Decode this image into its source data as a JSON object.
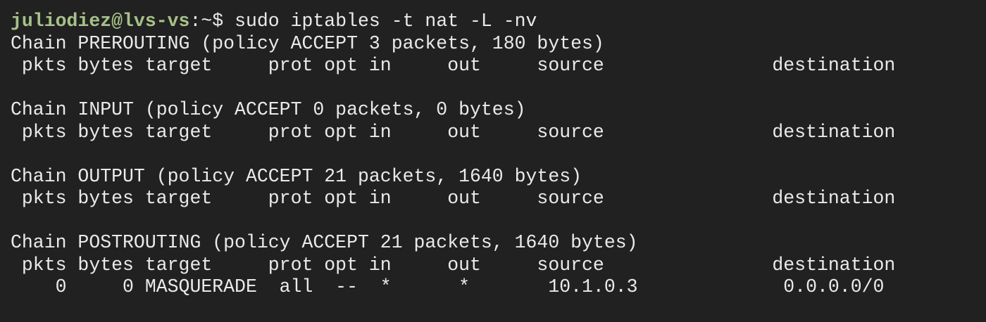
{
  "terminal": {
    "prompt": {
      "user_host": "juliodiez@lvs-vs",
      "path_symbol": ":~$",
      "command": " sudo iptables -t nat -L -nv"
    },
    "lines": [
      "Chain PREROUTING (policy ACCEPT 3 packets, 180 bytes)",
      " pkts bytes target     prot opt in     out     source               destination",
      "",
      "Chain INPUT (policy ACCEPT 0 packets, 0 bytes)",
      " pkts bytes target     prot opt in     out     source               destination",
      "",
      "Chain OUTPUT (policy ACCEPT 21 packets, 1640 bytes)",
      " pkts bytes target     prot opt in     out     source               destination",
      "",
      "Chain POSTROUTING (policy ACCEPT 21 packets, 1640 bytes)",
      " pkts bytes target     prot opt in     out     source               destination",
      "    0     0 MASQUERADE  all  --  *      *       10.1.0.3             0.0.0.0/0"
    ],
    "colors": {
      "background": "#212121",
      "foreground": "#eaeaea",
      "prompt_user": "#a6c189"
    }
  }
}
